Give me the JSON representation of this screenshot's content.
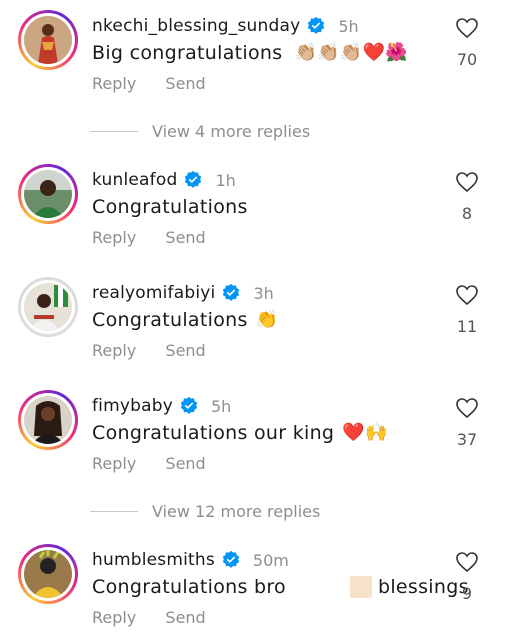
{
  "comments": [
    {
      "username": "nkechi_blessing_sunday",
      "time": "5h",
      "text": "Big congratulations",
      "emoji": "👏🏼👏🏼👏🏼❤️🌺",
      "likes": "70",
      "reply": "Reply",
      "send": "Send"
    },
    {
      "username": "kunleafod",
      "time": "1h",
      "text": "Congratulations",
      "emoji": "",
      "likes": "8",
      "reply": "Reply",
      "send": "Send"
    },
    {
      "username": "realyomifabiyi",
      "time": "3h",
      "text": "Congratulations",
      "emoji": "👏",
      "likes": "11",
      "reply": "Reply",
      "send": "Send"
    },
    {
      "username": "fimybaby",
      "time": "5h",
      "text": "Congratulations our king",
      "emoji": "❤️🙌",
      "likes": "37",
      "reply": "Reply",
      "send": "Send"
    },
    {
      "username": "humblesmiths",
      "time": "50m",
      "text": "Congratulations bro",
      "text2": "blessings",
      "emoji": "",
      "likes": "9",
      "reply": "Reply",
      "send": "Send"
    }
  ],
  "view_more": [
    "View 4 more replies",
    "View 12 more replies"
  ],
  "colors": {
    "verified": "#0095f6",
    "muted": "#8e8e8e"
  }
}
